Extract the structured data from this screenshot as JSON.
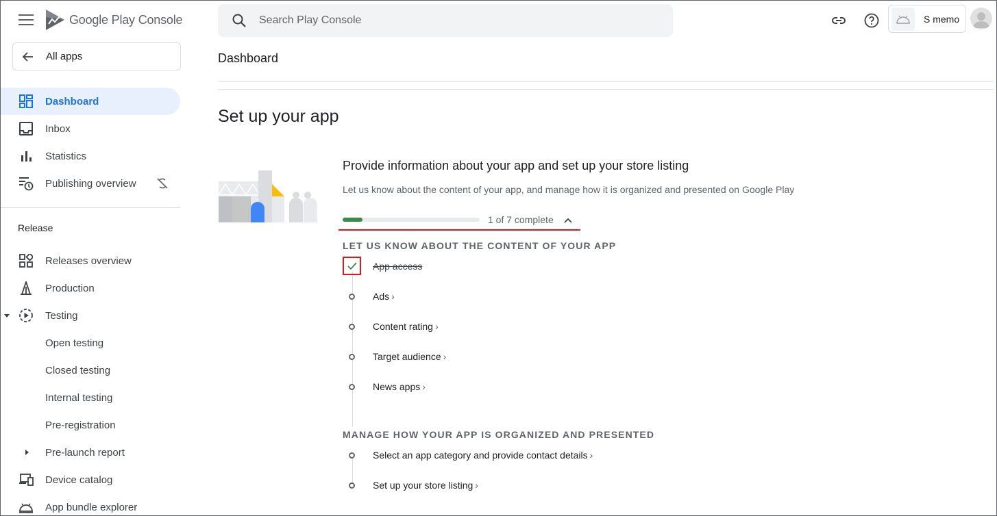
{
  "header": {
    "logo_text_primary": "Google Play",
    "logo_text_secondary": "Console",
    "search_placeholder": "Search Play Console",
    "account_name": "S memo",
    "page_title": "Dashboard"
  },
  "sidebar": {
    "all_apps_label": "All apps",
    "items": [
      {
        "label": "Dashboard",
        "icon": "dashboard-icon",
        "active": true
      },
      {
        "label": "Inbox",
        "icon": "inbox-icon"
      },
      {
        "label": "Statistics",
        "icon": "bar-chart-icon"
      },
      {
        "label": "Publishing overview",
        "icon": "publishing-icon",
        "extra_icon": "sync-off-icon"
      }
    ],
    "release_header": "Release",
    "release_items": [
      {
        "label": "Releases overview",
        "icon": "releases-grid-icon"
      },
      {
        "label": "Production",
        "icon": "production-icon"
      },
      {
        "label": "Testing",
        "icon": "testing-icon",
        "expanded": true
      },
      {
        "label": "Open testing"
      },
      {
        "label": "Closed testing"
      },
      {
        "label": "Internal testing"
      },
      {
        "label": "Pre-registration"
      },
      {
        "label": "Pre-launch report",
        "collapsed": true
      },
      {
        "label": "Device catalog",
        "icon": "devices-icon"
      },
      {
        "label": "App bundle explorer",
        "icon": "android-icon"
      }
    ]
  },
  "main": {
    "setup_title": "Set up your app",
    "card": {
      "title": "Provide information about your app and set up your store listing",
      "description": "Let us know about the content of your app, and manage how it is organized and presented on Google Play",
      "progress_text": "1 of 7 complete",
      "progress_fraction": 0.142857
    },
    "group1": {
      "header": "LET US KNOW ABOUT THE CONTENT OF YOUR APP",
      "tasks": [
        {
          "label": "App access",
          "done": true
        },
        {
          "label": "Ads",
          "done": false
        },
        {
          "label": "Content rating",
          "done": false
        },
        {
          "label": "Target audience",
          "done": false
        },
        {
          "label": "News apps",
          "done": false
        }
      ]
    },
    "group2": {
      "header": "MANAGE HOW YOUR APP IS ORGANIZED AND PRESENTED",
      "tasks": [
        {
          "label": "Select an app category and provide contact details",
          "done": false
        },
        {
          "label": "Set up your store listing",
          "done": false
        }
      ]
    }
  },
  "colors": {
    "accent_blue": "#1a73e8",
    "active_bg": "#e8f0fe",
    "progress_green": "#3d8a48",
    "highlight_red": "#e0161a"
  }
}
